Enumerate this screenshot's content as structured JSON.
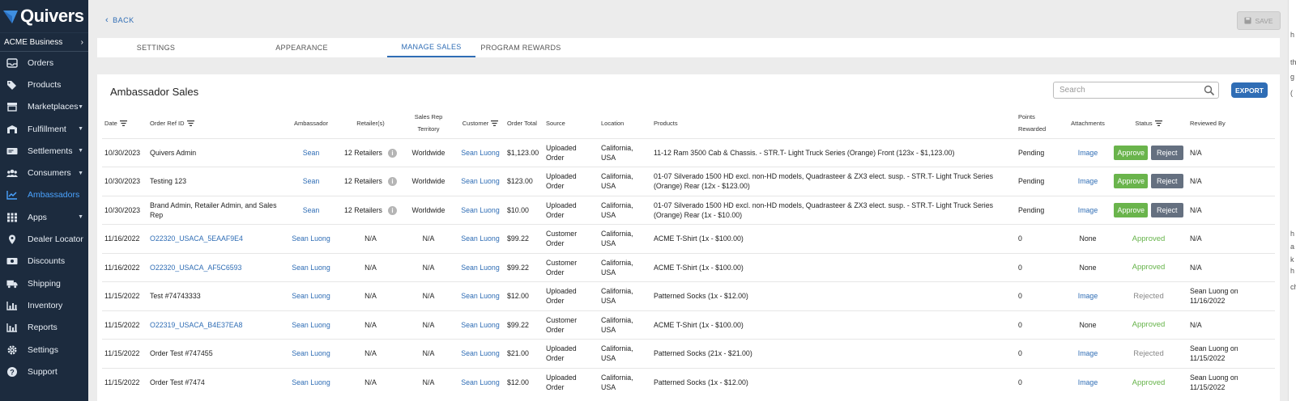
{
  "sidebar": {
    "brand": "Quivers",
    "business": "ACME Business",
    "items": [
      {
        "label": "Orders",
        "icon": "inbox-icon",
        "caret": false
      },
      {
        "label": "Products",
        "icon": "tags-icon",
        "caret": false
      },
      {
        "label": "Marketplaces",
        "icon": "store-icon",
        "caret": true
      },
      {
        "label": "Fulfillment",
        "icon": "warehouse-icon",
        "caret": true
      },
      {
        "label": "Settlements",
        "icon": "money-icon",
        "caret": true
      },
      {
        "label": "Consumers",
        "icon": "users-icon",
        "caret": true
      },
      {
        "label": "Ambassadors",
        "icon": "chart-line-icon",
        "caret": false,
        "active": true
      },
      {
        "label": "Apps",
        "icon": "grid-icon",
        "caret": true
      },
      {
        "label": "Dealer Locator",
        "icon": "map-pin-icon",
        "caret": false
      },
      {
        "label": "Discounts",
        "icon": "ticket-icon",
        "caret": false
      },
      {
        "label": "Shipping",
        "icon": "truck-icon",
        "caret": false
      },
      {
        "label": "Inventory",
        "icon": "bar-chart-icon",
        "caret": false
      },
      {
        "label": "Reports",
        "icon": "reports-icon",
        "caret": false
      },
      {
        "label": "Settings",
        "icon": "gear-icon",
        "caret": false
      },
      {
        "label": "Support",
        "icon": "help-icon",
        "caret": false
      }
    ]
  },
  "header": {
    "back_label": "BACK",
    "save_label": "SAVE"
  },
  "tabs": [
    {
      "label": "SETTINGS"
    },
    {
      "label": "APPEARANCE"
    },
    {
      "label": "MANAGE SALES",
      "active": true
    },
    {
      "label": "PROGRAM REWARDS"
    }
  ],
  "card": {
    "title": "Ambassador Sales",
    "search_placeholder": "Search",
    "export_label": "EXPORT"
  },
  "columns": {
    "date": "Date",
    "order_ref": "Order Ref ID",
    "ambassador": "Ambassador",
    "retailers": "Retailer(s)",
    "territory_1": "Sales Rep",
    "territory_2": "Territory",
    "customer": "Customer",
    "total": "Order Total",
    "source": "Source",
    "location": "Location",
    "products": "Products",
    "points_1": "Points",
    "points_2": "Rewarded",
    "attachments": "Attachments",
    "status": "Status",
    "reviewed": "Reviewed By"
  },
  "rows": [
    {
      "date": "10/30/2023",
      "ref": "Quivers Admin",
      "ref_link": false,
      "ambassador": "Sean",
      "retailers": "12 Retailers",
      "territory": "Worldwide",
      "customer": "Sean Luong",
      "total": "$1,123.00",
      "source": "Uploaded Order",
      "location": "California, USA",
      "products": "11-12 Ram 3500 Cab & Chassis. - STR.T- Light Truck Series (Orange) Front (123x - $1,123.00)",
      "points": "Pending",
      "attachment": "Image",
      "status": "actions",
      "approve": "Approve",
      "reject": "Reject",
      "reviewed": "N/A"
    },
    {
      "date": "10/30/2023",
      "ref": "Testing 123",
      "ref_link": false,
      "ambassador": "Sean",
      "retailers": "12 Retailers",
      "territory": "Worldwide",
      "customer": "Sean Luong",
      "total": "$123.00",
      "source": "Uploaded Order",
      "location": "California, USA",
      "products": "01-07 Silverado 1500 HD excl. non-HD models, Quadrasteer & ZX3 elect. susp. - STR.T- Light Truck Series (Orange) Rear (12x - $123.00)",
      "points": "Pending",
      "attachment": "Image",
      "status": "actions",
      "approve": "Approve",
      "reject": "Reject",
      "reviewed": "N/A"
    },
    {
      "date": "10/30/2023",
      "ref": "Brand Admin, Retailer Admin, and Sales Rep",
      "ref_link": false,
      "ambassador": "Sean",
      "retailers": "12 Retailers",
      "territory": "Worldwide",
      "customer": "Sean Luong",
      "total": "$10.00",
      "source": "Uploaded Order",
      "location": "California, USA",
      "products": "01-07 Silverado 1500 HD excl. non-HD models, Quadrasteer & ZX3 elect. susp. - STR.T- Light Truck Series (Orange) Rear (1x - $10.00)",
      "points": "Pending",
      "attachment": "Image",
      "status": "actions",
      "approve": "Approve",
      "reject": "Reject",
      "reviewed": "N/A"
    },
    {
      "date": "11/16/2022",
      "ref": "O22320_USACA_5EAAF9E4",
      "ref_link": true,
      "ambassador": "Sean Luong",
      "retailers": "N/A",
      "territory": "N/A",
      "customer": "Sean Luong",
      "total": "$99.22",
      "source": "Customer Order",
      "location": "California, USA",
      "products": "ACME T-Shirt (1x - $100.00)",
      "points": "0",
      "attachment": "None",
      "status": "Approved",
      "reviewed": "N/A"
    },
    {
      "date": "11/16/2022",
      "ref": "O22320_USACA_AF5C6593",
      "ref_link": true,
      "ambassador": "Sean Luong",
      "retailers": "N/A",
      "territory": "N/A",
      "customer": "Sean Luong",
      "total": "$99.22",
      "source": "Customer Order",
      "location": "California, USA",
      "products": "ACME T-Shirt (1x - $100.00)",
      "points": "0",
      "attachment": "None",
      "status": "Approved",
      "reviewed": "N/A"
    },
    {
      "date": "11/15/2022",
      "ref": "Test #74743333",
      "ref_link": false,
      "ambassador": "Sean Luong",
      "retailers": "N/A",
      "territory": "N/A",
      "customer": "Sean Luong",
      "total": "$12.00",
      "source": "Uploaded Order",
      "location": "California, USA",
      "products": "Patterned Socks (1x - $12.00)",
      "points": "0",
      "attachment": "Image",
      "status": "Rejected",
      "reviewed": "Sean Luong on 11/16/2022"
    },
    {
      "date": "11/15/2022",
      "ref": "O22319_USACA_B4E37EA8",
      "ref_link": true,
      "ambassador": "Sean Luong",
      "retailers": "N/A",
      "territory": "N/A",
      "customer": "Sean Luong",
      "total": "$99.22",
      "source": "Customer Order",
      "location": "California, USA",
      "products": "ACME T-Shirt (1x - $100.00)",
      "points": "0",
      "attachment": "None",
      "status": "Approved",
      "reviewed": "N/A"
    },
    {
      "date": "11/15/2022",
      "ref": "Order Test #747455",
      "ref_link": false,
      "ambassador": "Sean Luong",
      "retailers": "N/A",
      "territory": "N/A",
      "customer": "Sean Luong",
      "total": "$21.00",
      "source": "Uploaded Order",
      "location": "California, USA",
      "products": "Patterned Socks (21x - $21.00)",
      "points": "0",
      "attachment": "Image",
      "status": "Rejected",
      "reviewed": "Sean Luong on 11/15/2022"
    },
    {
      "date": "11/15/2022",
      "ref": "Order Test #7474",
      "ref_link": false,
      "ambassador": "Sean Luong",
      "retailers": "N/A",
      "territory": "N/A",
      "customer": "Sean Luong",
      "total": "$12.00",
      "source": "Uploaded Order",
      "location": "California, USA",
      "products": "Patterned Socks (1x - $12.00)",
      "points": "0",
      "attachment": "Image",
      "status": "Approved",
      "reviewed": "Sean Luong on 11/15/2022"
    }
  ],
  "edge_text": [
    "h",
    "th",
    "g",
    "(",
    "h",
    "a",
    "k",
    "h",
    "ch"
  ],
  "colors": {
    "sidebar_bg": "#1c2b3e",
    "accent": "#2f6db5",
    "approve": "#6ab44c",
    "reject": "#657080",
    "approved_text": "#66b34a"
  }
}
